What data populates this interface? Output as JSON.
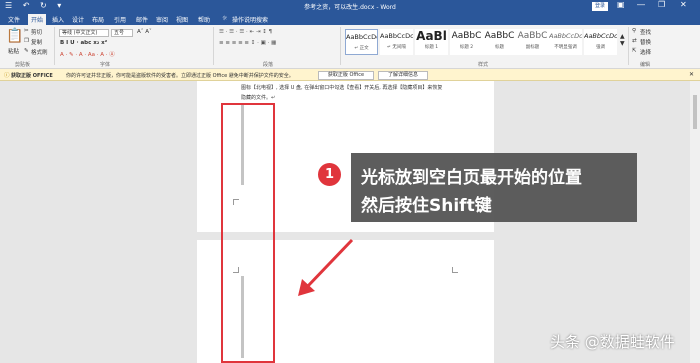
{
  "window": {
    "title": "参考之资，可以改生.docx - Word",
    "quick_access": "☰ ↶ ↻ ▾",
    "login": "登录",
    "controls": [
      "―",
      "❐",
      "✕"
    ]
  },
  "tabs": [
    "文件",
    "开始",
    "插入",
    "设计",
    "布局",
    "引用",
    "邮件",
    "审阅",
    "视图",
    "帮助",
    "操作说明搜索"
  ],
  "ribbon": {
    "clipboard": {
      "paste": "粘贴",
      "cut": "剪切",
      "copy": "复制",
      "format_painter": "格式刷",
      "label": "剪贴板"
    },
    "font": {
      "name": "等线 (中文正文)",
      "size": "五号",
      "label": "字体",
      "row2": "B I U · abc x₂ x²",
      "row3": "A · ✎ · A · Aa · A · Ⓐ",
      "grow": "Aˆ Aˇ"
    },
    "paragraph": {
      "row1": "☰ · ☰ · ☰ · ⇤ ⇥ ↕ ¶",
      "row2": "≡ ≡ ≡ ≡ ≡ ↕ · ▣ · ▦",
      "label": "段落"
    },
    "styles": {
      "label": "样式",
      "items": [
        {
          "preview": "AaBbCcDc",
          "name": "↵ 正文"
        },
        {
          "preview": "AaBbCcDc",
          "name": "↵ 无间隔"
        },
        {
          "preview": "AaBl",
          "name": "标题 1"
        },
        {
          "preview": "AaBbC",
          "name": "标题 2"
        },
        {
          "preview": "AaBbC",
          "name": "标题"
        },
        {
          "preview": "AaBbC",
          "name": "副标题"
        },
        {
          "preview": "AaBbCcDc",
          "name": "不明显强调"
        },
        {
          "preview": "AaBbCcDc",
          "name": "强调"
        }
      ]
    },
    "editing": {
      "find": "查找",
      "replace": "替换",
      "select": "选择",
      "label": "编辑"
    }
  },
  "notification": {
    "title": "获取正版 OFFICE",
    "message": "你的许可证并非正版，你可能是盗版软件的受害者。立即通过正版 Office 避免中断并保护文件的安全。",
    "btn_genuine": "获取正版 Office",
    "btn_more": "了解详细信息",
    "close": "✕"
  },
  "document": {
    "line1": "图标【北电视】, 选择 U 盘, 在弹出窗口中勾选【查看】开关后, 再选择【隐藏项目】来恢复",
    "line2": "隐藏的文件。↵"
  },
  "callout": {
    "number": "1",
    "line1": "光标放到空白页最开始的位置",
    "line2": "然后按住Shift键"
  },
  "watermark": "头条 @数据蛙软件",
  "colors": {
    "accent": "#2b579a",
    "highlight": "#e0353c",
    "callout_bg": "#555555"
  }
}
